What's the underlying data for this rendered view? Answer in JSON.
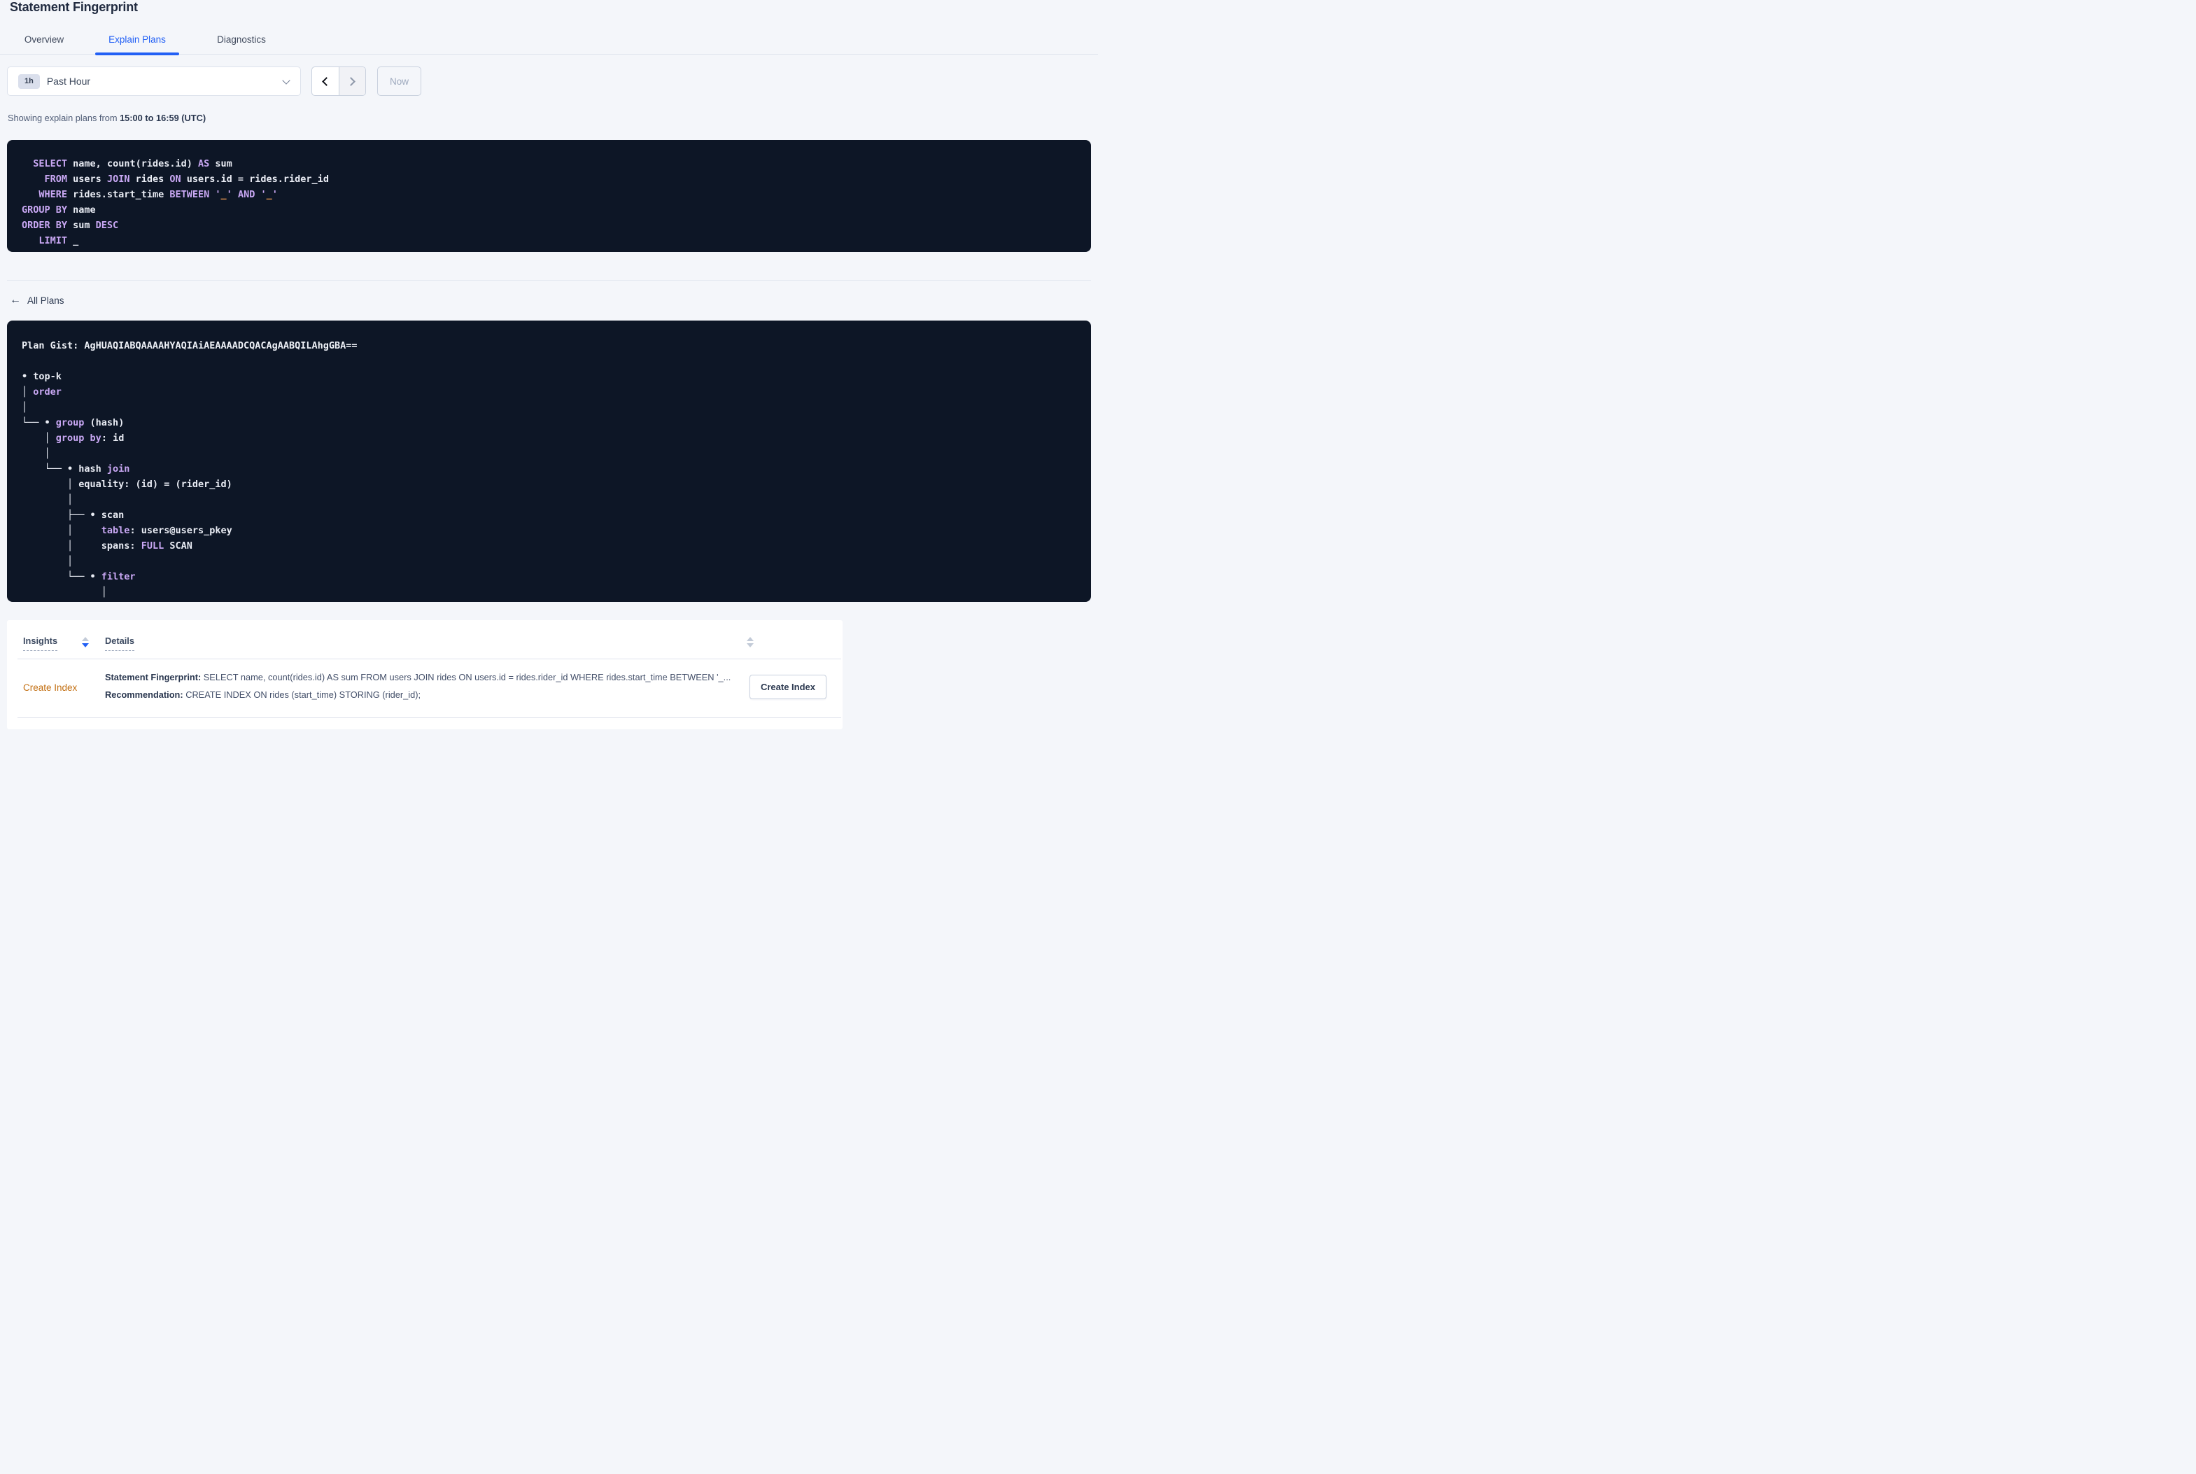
{
  "page_title": "Statement Fingerprint",
  "tabs": [
    {
      "label": "Overview",
      "active": false
    },
    {
      "label": "Explain Plans",
      "active": true
    },
    {
      "label": "Diagnostics",
      "active": false
    }
  ],
  "time_picker": {
    "badge": "1h",
    "value": "Past Hour",
    "now_label": "Now"
  },
  "range_caption": {
    "prefix": "Showing explain plans from ",
    "range": "15:00 to 16:59 (UTC)"
  },
  "sql_editor": {
    "lines": [
      [
        {
          "t": "  ",
          "c": "p"
        },
        {
          "t": "SELECT",
          "c": "k"
        },
        {
          "t": " name, count(rides.id) ",
          "c": "p"
        },
        {
          "t": "AS",
          "c": "k"
        },
        {
          "t": " sum",
          "c": "p"
        }
      ],
      [
        {
          "t": "    ",
          "c": "p"
        },
        {
          "t": "FROM",
          "c": "k"
        },
        {
          "t": " users ",
          "c": "p"
        },
        {
          "t": "JOIN",
          "c": "k"
        },
        {
          "t": " rides ",
          "c": "p"
        },
        {
          "t": "ON",
          "c": "k"
        },
        {
          "t": " users.id = rides.rider_id",
          "c": "p"
        }
      ],
      [
        {
          "t": "   ",
          "c": "p"
        },
        {
          "t": "WHERE",
          "c": "k"
        },
        {
          "t": " rides.start_time ",
          "c": "p"
        },
        {
          "t": "BETWEEN",
          "c": "k"
        },
        {
          "t": " ",
          "c": "p"
        },
        {
          "t": "'",
          "c": "k"
        },
        {
          "t": "_",
          "c": "o"
        },
        {
          "t": "'",
          "c": "k"
        },
        {
          "t": " ",
          "c": "p"
        },
        {
          "t": "AND",
          "c": "k"
        },
        {
          "t": " ",
          "c": "p"
        },
        {
          "t": "'",
          "c": "k"
        },
        {
          "t": "_",
          "c": "o"
        },
        {
          "t": "'",
          "c": "k"
        }
      ],
      [
        {
          "t": "GROUP BY",
          "c": "k"
        },
        {
          "t": " name",
          "c": "p"
        }
      ],
      [
        {
          "t": "ORDER BY",
          "c": "k"
        },
        {
          "t": " sum ",
          "c": "p"
        },
        {
          "t": "DESC",
          "c": "k"
        }
      ],
      [
        {
          "t": "   ",
          "c": "p"
        },
        {
          "t": "LIMIT",
          "c": "k"
        },
        {
          "t": " _",
          "c": "p"
        }
      ]
    ]
  },
  "back_link": {
    "label": "All Plans"
  },
  "plan_gist": {
    "text": "Plan Gist: AgHUAQIABQAAAAHYAQIAiAEAAAADCQACAgAABQILAhgGBA=="
  },
  "plan_tree": {
    "lines": [
      [],
      [
        {
          "t": "• top-k",
          "c": "p"
        }
      ],
      [
        {
          "t": "│ ",
          "c": "p"
        },
        {
          "t": "order",
          "c": "k"
        }
      ],
      [
        {
          "t": "│",
          "c": "p"
        }
      ],
      [
        {
          "t": "└── • ",
          "c": "p"
        },
        {
          "t": "group",
          "c": "k"
        },
        {
          "t": " (hash)",
          "c": "p"
        }
      ],
      [
        {
          "t": "    │ ",
          "c": "p"
        },
        {
          "t": "group by",
          "c": "k"
        },
        {
          "t": ": id",
          "c": "p"
        }
      ],
      [
        {
          "t": "    │",
          "c": "p"
        }
      ],
      [
        {
          "t": "    └── • hash ",
          "c": "p"
        },
        {
          "t": "join",
          "c": "k"
        }
      ],
      [
        {
          "t": "        │ equality: (id) = (rider_id)",
          "c": "p"
        }
      ],
      [
        {
          "t": "        │",
          "c": "p"
        }
      ],
      [
        {
          "t": "        ├── • scan",
          "c": "p"
        }
      ],
      [
        {
          "t": "        │     ",
          "c": "p"
        },
        {
          "t": "table",
          "c": "k"
        },
        {
          "t": ": users@users_pkey",
          "c": "p"
        }
      ],
      [
        {
          "t": "        │     spans: ",
          "c": "p"
        },
        {
          "t": "FULL",
          "c": "k"
        },
        {
          "t": " SCAN",
          "c": "p"
        }
      ],
      [
        {
          "t": "        │",
          "c": "p"
        }
      ],
      [
        {
          "t": "        └── • ",
          "c": "p"
        },
        {
          "t": "filter",
          "c": "k"
        }
      ],
      [
        {
          "t": "              │",
          "c": "p"
        }
      ]
    ]
  },
  "insights_table": {
    "columns": [
      {
        "label": "Insights"
      },
      {
        "label": "Details"
      }
    ],
    "rows": [
      {
        "insight": "Create Index",
        "fingerprint_label": "Statement Fingerprint:",
        "fingerprint": " SELECT name, count(rides.id) AS sum FROM users JOIN rides ON users.id = rides.rider_id WHERE rides.start_time BETWEEN '_...",
        "recommendation_label": "Recommendation:",
        "recommendation": " CREATE INDEX ON rides (start_time) STORING (rider_id);",
        "action_label": "Create Index"
      }
    ]
  },
  "colors": {
    "page_background": "#f4f6fa",
    "code_background": "#0d1626",
    "accent_blue": "#2260f5",
    "keyword_purple": "#c9a8f4",
    "code_text": "#e9ecf4",
    "placeholder_orange": "#fda253",
    "insight_link_orange": "#c26e10"
  }
}
